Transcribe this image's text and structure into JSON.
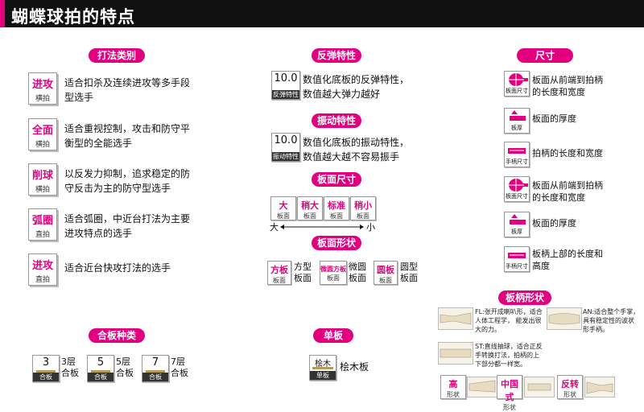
{
  "title": "蝴蝶球拍的特点",
  "colors": {
    "accent": "#e3007f",
    "header_bg": "#111111"
  },
  "sections": {
    "play_style": {
      "title": "打法类别",
      "items": [
        {
          "main": "进攻",
          "sub": "横拍",
          "desc": [
            "适合扣杀及连续进攻等多手段",
            "型选手"
          ]
        },
        {
          "main": "全面",
          "sub": "横拍",
          "desc": [
            "适合重视控制，攻击和防守平",
            "衡型的全能选手"
          ]
        },
        {
          "main": "削球",
          "sub": "横拍",
          "desc": [
            "以反发力抑制，追求稳定的防",
            "守反击为主的防守型选手"
          ]
        },
        {
          "main": "弧圈",
          "sub": "直拍",
          "desc": [
            "适合弧圈，中近台打法为主要",
            "进攻特点的选手"
          ]
        },
        {
          "main": "进攻",
          "sub": "直拍",
          "desc": [
            "适合近台快攻打法的选手"
          ]
        }
      ]
    },
    "plies": {
      "title": "合板种类",
      "items": [
        {
          "num": "3",
          "sub": "合板",
          "l1": "3层",
          "l2": "合板"
        },
        {
          "num": "5",
          "sub": "合板",
          "l1": "5层",
          "l2": "合板"
        },
        {
          "num": "7",
          "sub": "合板",
          "l1": "7层",
          "l2": "合板"
        }
      ]
    },
    "rebound": {
      "title": "反弹特性",
      "value": "10.0",
      "sub": "反弹特性",
      "desc": [
        "数值化底板的反弹特性，",
        "数值越大弹力越好"
      ]
    },
    "vibration": {
      "title": "振动特性",
      "value": "10.0",
      "sub": "振动特性",
      "desc": [
        "数值化底板的振动特性，",
        "数值越大越不容易振手"
      ]
    },
    "blade_size": {
      "title": "板面尺寸",
      "items": [
        {
          "main": "大",
          "sub": "板面"
        },
        {
          "main": "稍大",
          "sub": "板面"
        },
        {
          "main": "标准",
          "sub": "板面"
        },
        {
          "main": "稍小",
          "sub": "板面"
        }
      ],
      "big": "大",
      "small": "小"
    },
    "blade_shape": {
      "title": "板面形状",
      "items": [
        {
          "main": "方板",
          "sub": "板面",
          "l1": "方型",
          "l2": "板面"
        },
        {
          "main": "微圆方板",
          "sub": "板面",
          "l1": "微圆",
          "l2": "板面"
        },
        {
          "main": "圆板",
          "sub": "板面",
          "l1": "圆型",
          "l2": "板面"
        }
      ]
    },
    "single": {
      "title": "单板",
      "main": "桧木",
      "sub": "单板",
      "label": "桧木板"
    },
    "dimensions": {
      "title": "尺寸",
      "items": [
        {
          "sub": "板面尺寸",
          "desc": [
            "板面从前端到拍柄",
            "的长度和宽度"
          ]
        },
        {
          "sub": "板厚",
          "desc": [
            "板面的厚度"
          ]
        },
        {
          "sub": "手柄尺寸",
          "desc": [
            "拍柄的长度和宽度"
          ]
        },
        {
          "sub": "板面尺寸",
          "desc": [
            "板面从前端到拍柄",
            "的长度和宽度"
          ]
        },
        {
          "sub": "板厚",
          "desc": [
            "板面的厚度"
          ]
        },
        {
          "sub": "手柄尺寸",
          "desc": [
            "板柄上部的长度和",
            "高度"
          ]
        }
      ]
    },
    "handle": {
      "title": "板柄形状",
      "fl": [
        "FL:张开成喇叭形，适合",
        "人体工程学， 能发出很",
        "大的力。"
      ],
      "an": [
        "AN:适合整个手掌，",
        "具有稳定性的波状",
        "形手柄。"
      ],
      "st": [
        "ST:直线抽球，适合正反",
        "手转换打法，拍柄的上",
        "下部分都一样宽。"
      ],
      "tags": [
        {
          "main": "高",
          "sub": "形状"
        },
        {
          "main": "中国式",
          "sub": "形状"
        },
        {
          "main": "反转",
          "sub": "形状"
        }
      ]
    }
  }
}
